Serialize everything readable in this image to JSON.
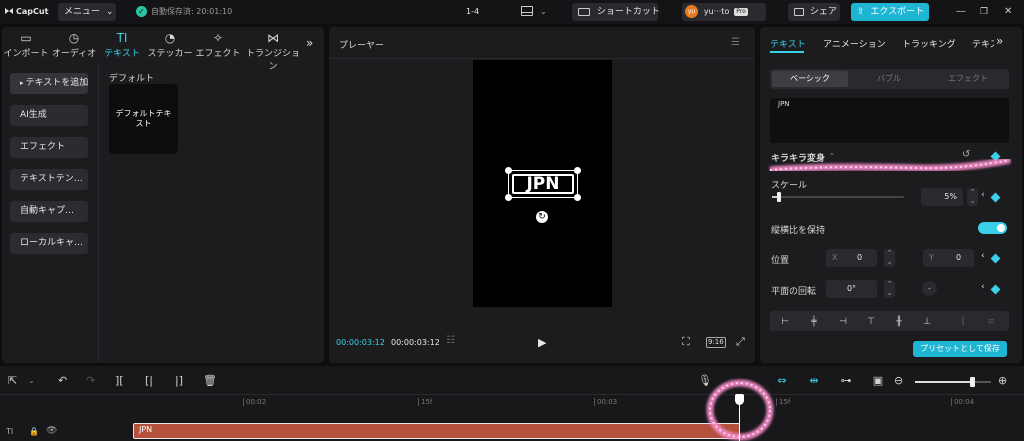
{
  "topbar": {
    "app_name": "CapCut",
    "menu_label": "メニュー",
    "autosave_status": "自動保存済: 20:01:10",
    "project_name": "1-4",
    "shortcut_label": "ショートカット",
    "user_name": "yu···to",
    "user_initial": "yu",
    "pro_badge": "Pro",
    "share_label": "シェア",
    "export_label": "エクスポート"
  },
  "media_tabs": [
    {
      "icon": "import-icon",
      "label": "インポート"
    },
    {
      "icon": "audio-icon",
      "label": "オーディオ"
    },
    {
      "icon": "text-icon",
      "label": "テキスト",
      "glyph": "TI"
    },
    {
      "icon": "sticker-icon",
      "label": "ステッカー"
    },
    {
      "icon": "effect-icon",
      "label": "エフェクト"
    },
    {
      "icon": "transition-icon",
      "label": "トランジション"
    }
  ],
  "text_sidebar": [
    "テキストを追加",
    "AI生成",
    "エフェクト",
    "テキストテン…",
    "自動キャプ…",
    "ローカルキャ…"
  ],
  "default_section": {
    "title": "デフォルト",
    "card_text": "デフォルトテキスト"
  },
  "player": {
    "title": "プレーヤー",
    "canvas_text": "JPN",
    "current_time": "00:00:03:12",
    "total_time": "00:00:03:12",
    "aspect_label": "9:16"
  },
  "inspector": {
    "tabs": [
      "テキスト",
      "アニメーション",
      "トラッキング",
      "テキス"
    ],
    "subtabs": [
      "ベーシック",
      "バブル",
      "エフェクト"
    ],
    "text_value": "JPN",
    "sparkle_label": "キラキラ変身",
    "scale_label": "スケール",
    "scale_value": "5%",
    "scale_fraction": 0.05,
    "keep_ratio_label": "縦横比を保持",
    "position_label": "位置",
    "x_label": "X",
    "x_value": "0",
    "y_label": "Y",
    "y_value": "0",
    "rotation_label": "平面の回転",
    "rotation_value": "0°",
    "save_preset_label": "プリセットとして保存"
  },
  "timeline": {
    "ruler_labels": [
      "00:02",
      "15f",
      "00:03",
      "15f",
      "00:04"
    ],
    "clip_label": "JPN",
    "zoom_fraction": 0.75
  },
  "colors": {
    "accent": "#3ad0e8",
    "export_bg": "#1fb6d3",
    "clip_bg": "#b5503c",
    "sparkle": "#f58ac8"
  }
}
